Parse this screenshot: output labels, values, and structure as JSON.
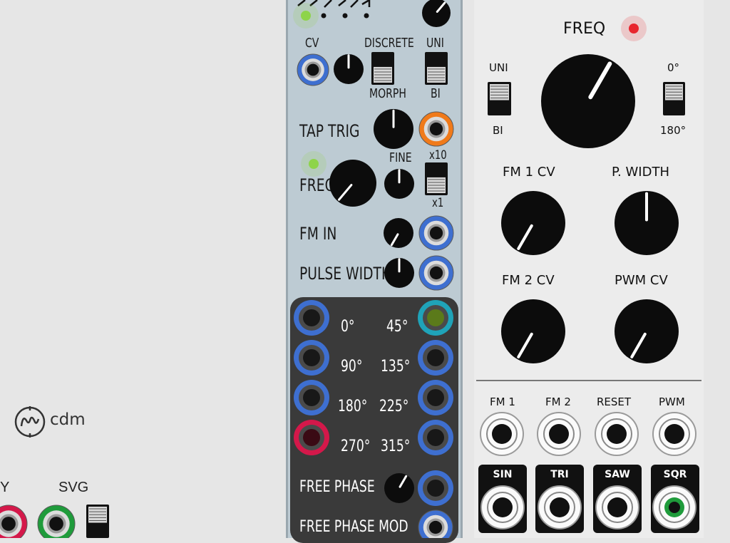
{
  "left_rack": {
    "logo_text": "cdm",
    "label_y": "Y",
    "label_svg": "SVG"
  },
  "phase_module": {
    "cv_label": "CV",
    "discrete_label": "DISCRETE",
    "morph_label": "MORPH",
    "uni_label": "UNI",
    "bi_label": "BI",
    "tap_trig_label": "TAP TRIG",
    "fine_label": "FINE",
    "x10_label": "x10",
    "x1_label": "x1",
    "freq_label": "FREQ",
    "fm_in_label": "FM IN",
    "pulse_width_label": "PULSE WIDTH",
    "phase_outputs": [
      "0°",
      "45°",
      "90°",
      "135°",
      "180°",
      "225°",
      "270°",
      "315°"
    ],
    "free_phase_label": "FREE PHASE",
    "free_phase_mod_label": "FREE PHASE MOD"
  },
  "osc_module": {
    "freq_label": "FREQ",
    "uni_label": "UNI",
    "bi_label": "BI",
    "deg0_label": "0°",
    "deg180_label": "180°",
    "fm1cv_label": "FM 1 CV",
    "pwidth_label": "P. WIDTH",
    "fm2cv_label": "FM 2 CV",
    "pwmcv_label": "PWM CV",
    "inputs": [
      "FM 1",
      "FM 2",
      "RESET",
      "PWM"
    ],
    "outputs": [
      "SIN",
      "TRI",
      "SAW",
      "SQR"
    ]
  },
  "colors": {
    "panel_center": "#bdcbd3",
    "panel_right": "#ececec",
    "jack_blue": "#3e6fd0",
    "jack_orange": "#f07a1a",
    "jack_red": "#d4184a",
    "jack_teal": "#1fa3b8",
    "jack_green": "#1f9b3b",
    "led_red": "#e8262e",
    "led_green": "#8ed44a"
  },
  "icons": [
    "cdm-logo-icon",
    "jack-icon",
    "knob-icon",
    "switch-icon",
    "led-icon"
  ]
}
